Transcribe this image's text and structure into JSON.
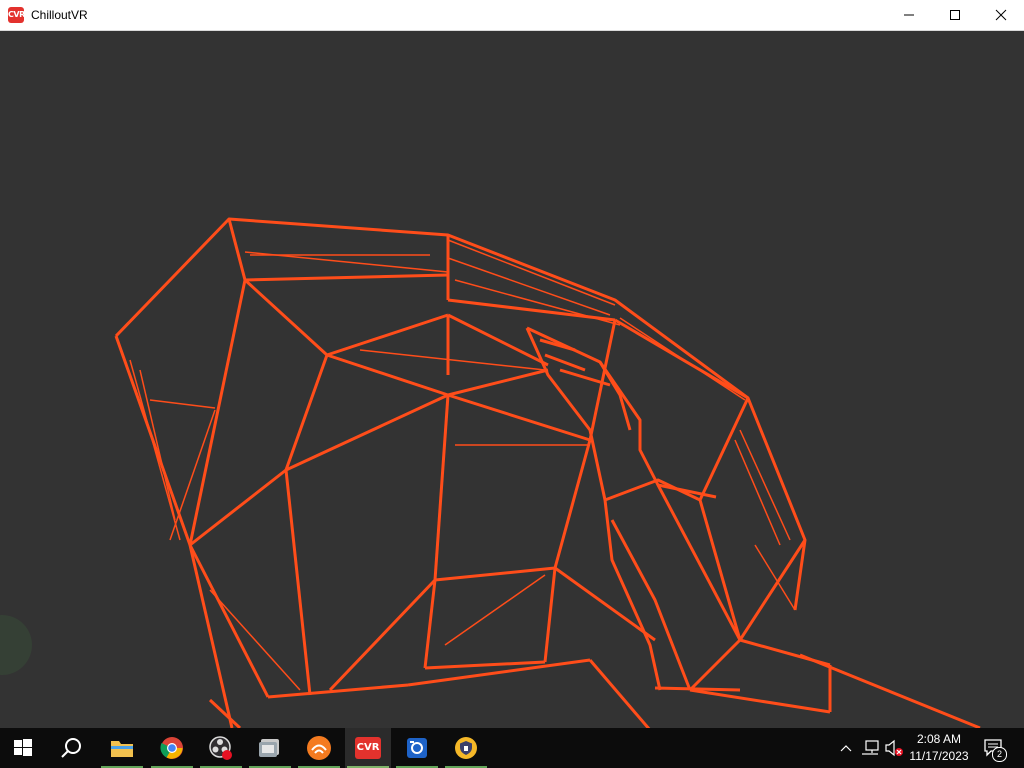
{
  "window": {
    "title": "ChilloutVR",
    "app_icon_text": "CVR",
    "accent_color": "#e3322d",
    "controls": [
      "minimize-icon",
      "maximize-icon",
      "close-icon"
    ]
  },
  "viewport": {
    "background": "#333333",
    "wireframe_color": "#ff4d1a"
  },
  "taskbar": {
    "items": [
      {
        "name": "start-button",
        "icon": "windows-logo-icon"
      },
      {
        "name": "search-button",
        "icon": "search-icon"
      },
      {
        "name": "file-explorer",
        "icon": "folder-icon"
      },
      {
        "name": "chrome",
        "icon": "chrome-icon"
      },
      {
        "name": "obs-studio",
        "icon": "obs-icon"
      },
      {
        "name": "app-unknown",
        "icon": "app-icon"
      },
      {
        "name": "sublime-or-app",
        "icon": "orange-app-icon"
      },
      {
        "name": "chilloutvr",
        "icon": "cvr-icon",
        "active": true
      },
      {
        "name": "screen-capture",
        "icon": "capture-icon"
      },
      {
        "name": "vpn-app",
        "icon": "shield-icon"
      }
    ],
    "tray": {
      "time": "2:08 AM",
      "date": "11/17/2023",
      "notification_count": "2",
      "icons": [
        "chevron-up-icon",
        "network-icon",
        "volume-muted-icon",
        "notification-icon"
      ]
    }
  }
}
